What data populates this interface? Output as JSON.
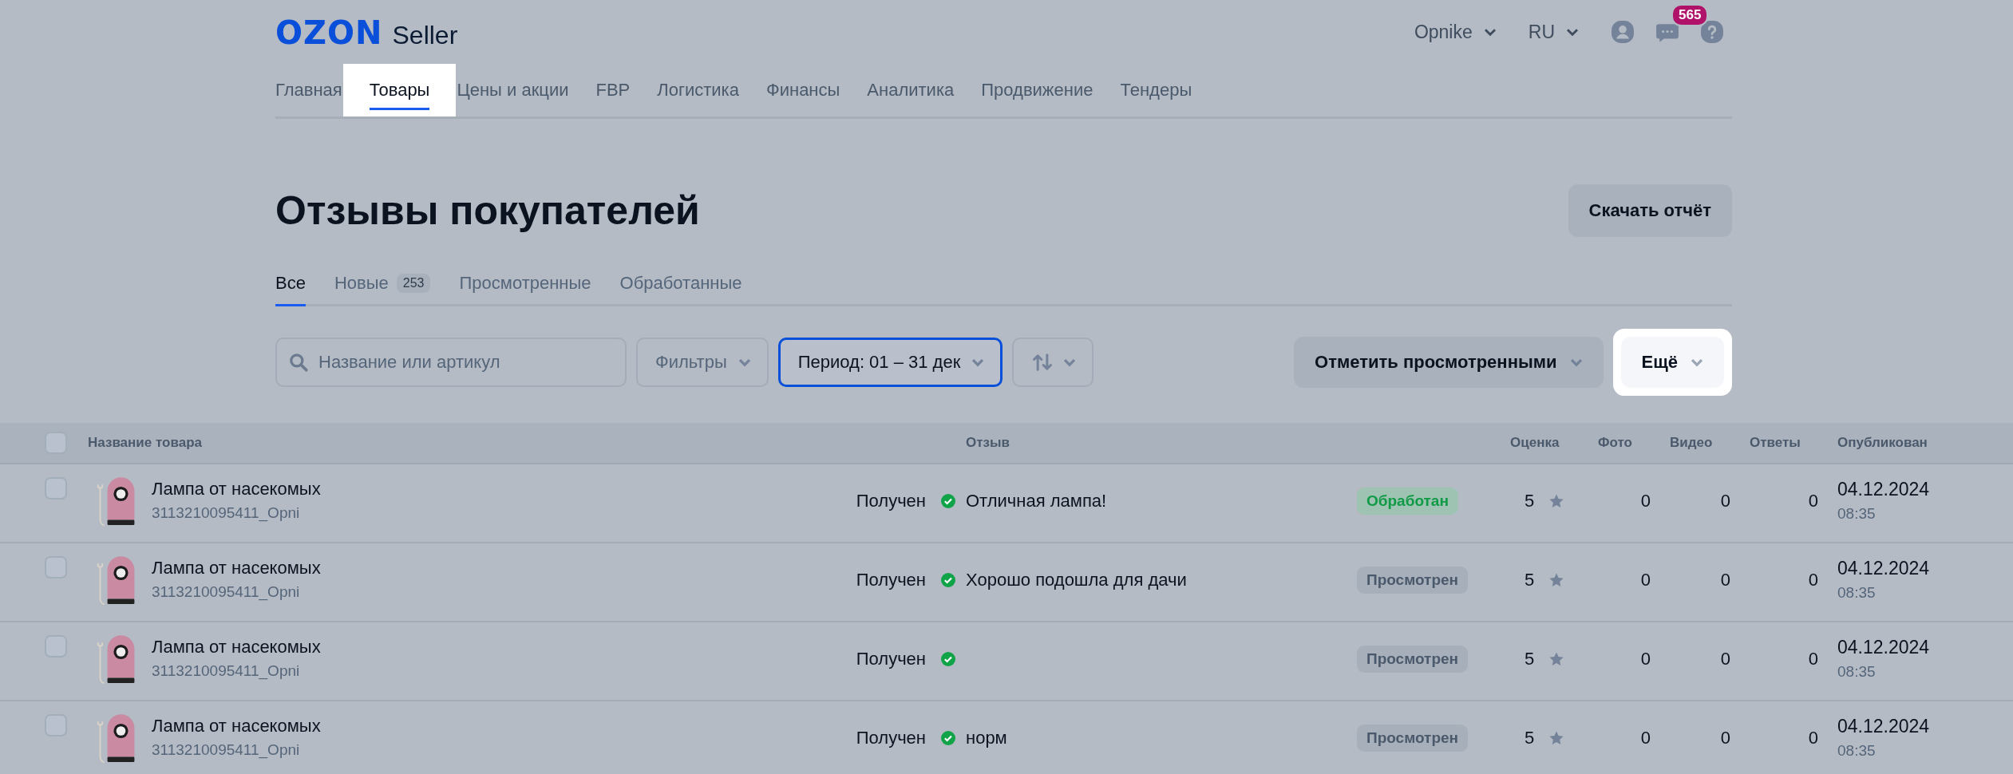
{
  "header": {
    "logo": {
      "brand": "OZON",
      "product": "Seller"
    },
    "account": "Opnike",
    "language": "RU",
    "messages_badge": "565"
  },
  "nav": [
    {
      "label": "Главная",
      "selected": false,
      "spotlight": false
    },
    {
      "label": "Товары",
      "selected": true,
      "spotlight": true
    },
    {
      "label": "Цены и акции",
      "selected": false,
      "spotlight": false
    },
    {
      "label": "FBP",
      "selected": false,
      "spotlight": false
    },
    {
      "label": "Логистика",
      "selected": false,
      "spotlight": false
    },
    {
      "label": "Финансы",
      "selected": false,
      "spotlight": false
    },
    {
      "label": "Аналитика",
      "selected": false,
      "spotlight": false
    },
    {
      "label": "Продвижение",
      "selected": false,
      "spotlight": false
    },
    {
      "label": "Тендеры",
      "selected": false,
      "spotlight": false
    }
  ],
  "page": {
    "title": "Отзывы покупателей",
    "download_button": "Скачать отчёт"
  },
  "tabs": [
    {
      "label": "Все",
      "selected": true
    },
    {
      "label": "Новые",
      "selected": false,
      "count": "253"
    },
    {
      "label": "Просмотренные",
      "selected": false
    },
    {
      "label": "Обработанные",
      "selected": false
    }
  ],
  "toolbar": {
    "search": {
      "placeholder": "Название или артикул"
    },
    "filters": {
      "label": "Фильтры"
    },
    "period": {
      "label": "Период: 01 – 31 дек",
      "active": true
    },
    "mark_viewed": {
      "label": "Отметить просмотренными",
      "spotlight": false
    },
    "more": {
      "label": "Ещё",
      "spotlight": true
    }
  },
  "table": {
    "select_all": {
      "checked": false
    },
    "columns": [
      "Название товара",
      "Отзыв",
      "Оценка",
      "Фото",
      "Видео",
      "Ответы",
      "Опубликован"
    ],
    "rows": [
      {
        "checked": false,
        "product": "Лампа от насекомых",
        "sku": "3113210095411_Opni",
        "delivery": "Получен",
        "review": "Отличная лампа!",
        "status": {
          "label": "Обработан",
          "kind": "processed"
        },
        "rating": "5",
        "photos": "0",
        "videos": "0",
        "answers": "0",
        "date": "04.12.2024",
        "time": "08:35"
      },
      {
        "checked": false,
        "product": "Лампа от насекомых",
        "sku": "3113210095411_Opni",
        "delivery": "Получен",
        "review": "Хорошо подошла для дачи",
        "status": {
          "label": "Просмотрен",
          "kind": "viewed"
        },
        "rating": "5",
        "photos": "0",
        "videos": "0",
        "answers": "0",
        "date": "04.12.2024",
        "time": "08:35"
      },
      {
        "checked": false,
        "product": "Лампа от насекомых",
        "sku": "3113210095411_Opni",
        "delivery": "Получен",
        "status": {
          "label": "Просмотрен",
          "kind": "viewed"
        },
        "rating": "5",
        "photos": "0",
        "videos": "0",
        "answers": "0",
        "date": "04.12.2024",
        "time": "08:35"
      },
      {
        "checked": false,
        "product": "Лампа от насекомых",
        "sku": "3113210095411_Opni",
        "delivery": "Получен",
        "review": "норм",
        "status": {
          "label": "Просмотрен",
          "kind": "viewed"
        },
        "rating": "5",
        "photos": "0",
        "videos": "0",
        "answers": "0",
        "date": "04.12.2024",
        "time": "08:35"
      }
    ]
  }
}
